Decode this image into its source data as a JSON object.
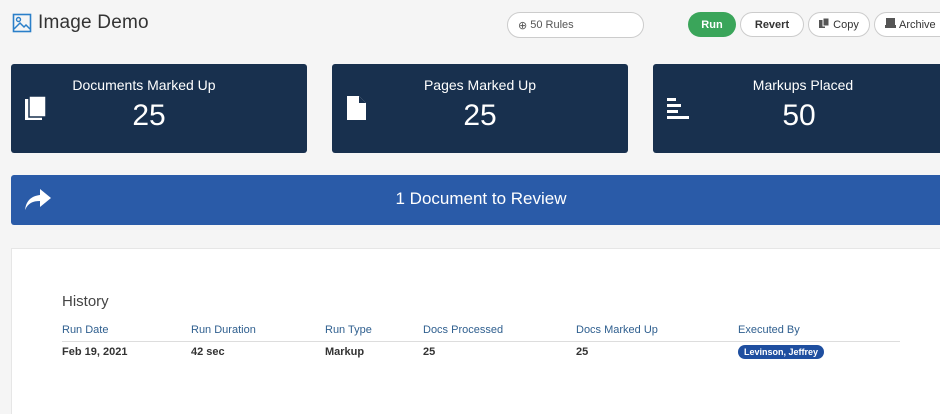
{
  "header": {
    "title": "Image Demo",
    "rules_label": "50 Rules",
    "run_label": "Run",
    "revert_label": "Revert",
    "copy_label": "Copy",
    "archive_label": "Archive"
  },
  "stats": [
    {
      "label": "Documents Marked Up",
      "value": "25",
      "icon": "documents-icon"
    },
    {
      "label": "Pages Marked Up",
      "value": "25",
      "icon": "page-icon"
    },
    {
      "label": "Markups Placed",
      "value": "50",
      "icon": "markups-icon"
    }
  ],
  "review": {
    "label": "1 Document to Review"
  },
  "history": {
    "title": "History",
    "columns": [
      "Run Date",
      "Run Duration",
      "Run Type",
      "Docs Processed",
      "Docs Marked Up",
      "Executed By"
    ],
    "rows": [
      {
        "run_date": "Feb 19, 2021",
        "duration": "42 sec",
        "type": "Markup",
        "processed": "25",
        "marked_up": "25",
        "executed_by": "Levinson, Jeffrey"
      }
    ]
  },
  "colors": {
    "card_bg": "#18304e",
    "banner_bg": "#2a5ba8",
    "run_green": "#3aa55a",
    "badge_blue": "#1f4fa0",
    "header_text": "#2f5f8f"
  }
}
